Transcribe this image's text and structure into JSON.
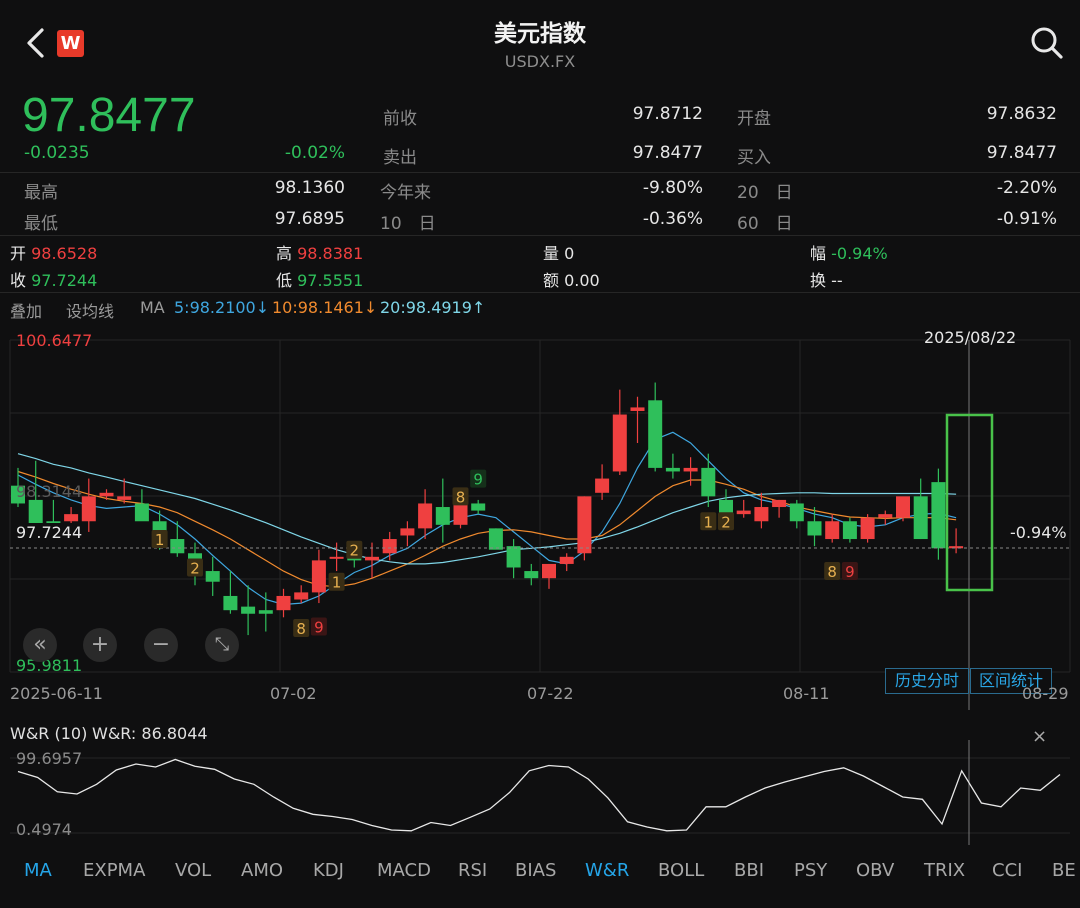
{
  "header": {
    "title": "美元指数",
    "subtitle": "USDX.FX",
    "logo": "W"
  },
  "quote": {
    "price": "97.8477",
    "change": "-0.0235",
    "change_pct": "-0.02%",
    "prev_close_label": "前收",
    "prev_close": "97.8712",
    "open_label": "开盘",
    "open": "97.8632",
    "sell_label": "卖出",
    "sell": "97.8477",
    "buy_label": "买入",
    "buy": "97.8477",
    "high_label": "最高",
    "high": "98.1360",
    "low_label": "最低",
    "low": "97.6895",
    "ytd_label": "今年来",
    "ytd": "-9.80%",
    "d20_label": "20　日",
    "d20": "-2.20%",
    "d10_label": "10　日",
    "d10": "-0.36%",
    "d60_label": "60　日",
    "d60": "-0.91%"
  },
  "bar_info": {
    "open_label": "开",
    "open": "98.6528",
    "high_label": "高",
    "high": "98.8381",
    "vol_label": "量",
    "vol": "0",
    "amp_label": "幅",
    "amp": "-0.94%",
    "close_label": "收",
    "close": "97.7244",
    "low_label": "低",
    "low": "97.5551",
    "amt_label": "额",
    "amt": "0.00",
    "turn_label": "换",
    "turn": "--"
  },
  "ma_bar": {
    "overlay": "叠加",
    "set_ma": "设均线",
    "ma": "MA",
    "ma5": "5:98.2100↓",
    "ma10": "10:98.1461↓",
    "ma20": "20:98.4919↑"
  },
  "colors": {
    "up": "#ef4040",
    "down": "#2fbf5b",
    "ma5": "#3fa7e0",
    "ma10": "#f08a2e",
    "ma20": "#7fd6e8",
    "accent": "#25a5e8"
  },
  "chart": {
    "y_max_label": "100.6477",
    "y_min_label": "95.9811",
    "cursor_price": "97.7244",
    "cursor_pct": "-0.94%",
    "cursor_date": "2025/08/22",
    "ghost_label": "98.3144",
    "dates": [
      "2025-06-11",
      "07-02",
      "07-22",
      "08-11",
      "08-29"
    ],
    "hist_btn": "历史分时",
    "range_btn": "区间统计",
    "td_marks": [
      "1",
      "2",
      "1",
      "2",
      "8",
      "9",
      "8",
      "9",
      "1",
      "2",
      "8",
      "9"
    ]
  },
  "chart_data": {
    "type": "candlestick",
    "ylim": [
      95.9811,
      100.6477
    ],
    "candles": [
      [
        98.6,
        98.85,
        98.3,
        98.35
      ],
      [
        98.4,
        98.95,
        98.0,
        98.05
      ],
      [
        98.1,
        98.4,
        97.9,
        98.0
      ],
      [
        98.1,
        98.3,
        97.95,
        98.2
      ],
      [
        98.1,
        98.7,
        97.95,
        98.45
      ],
      [
        98.45,
        98.55,
        98.4,
        98.5
      ],
      [
        98.4,
        98.7,
        98.35,
        98.45
      ],
      [
        98.35,
        98.55,
        98.2,
        98.1
      ],
      [
        98.1,
        98.25,
        97.7,
        97.8
      ],
      [
        97.85,
        98.1,
        97.6,
        97.65
      ],
      [
        97.65,
        97.8,
        97.2,
        97.4
      ],
      [
        97.4,
        97.6,
        97.05,
        97.25
      ],
      [
        97.05,
        97.4,
        96.8,
        96.85
      ],
      [
        96.9,
        97.2,
        96.5,
        96.8
      ],
      [
        96.85,
        97.1,
        96.55,
        96.8
      ],
      [
        96.85,
        97.15,
        96.75,
        97.05
      ],
      [
        97.0,
        97.2,
        96.95,
        97.1
      ],
      [
        97.1,
        97.7,
        96.95,
        97.55
      ],
      [
        97.6,
        97.8,
        97.4,
        97.6
      ],
      [
        97.6,
        97.75,
        97.45,
        97.55
      ],
      [
        97.55,
        97.8,
        97.3,
        97.6
      ],
      [
        97.65,
        97.95,
        97.55,
        97.85
      ],
      [
        97.9,
        98.1,
        97.75,
        98.0
      ],
      [
        98.0,
        98.55,
        97.85,
        98.35
      ],
      [
        98.3,
        98.7,
        97.8,
        98.05
      ],
      [
        98.05,
        98.45,
        98.0,
        98.35
      ],
      [
        98.35,
        98.4,
        98.2,
        98.25
      ],
      [
        98.0,
        98.0,
        97.75,
        97.7
      ],
      [
        97.75,
        97.85,
        97.3,
        97.45
      ],
      [
        97.4,
        97.5,
        97.2,
        97.3
      ],
      [
        97.3,
        97.5,
        97.15,
        97.5
      ],
      [
        97.5,
        97.65,
        97.4,
        97.6
      ],
      [
        97.65,
        98.45,
        97.55,
        98.45
      ],
      [
        98.5,
        98.9,
        98.4,
        98.7
      ],
      [
        98.8,
        99.95,
        98.75,
        99.6
      ],
      [
        99.65,
        99.85,
        99.2,
        99.7
      ],
      [
        99.8,
        100.05,
        98.8,
        98.85
      ],
      [
        98.85,
        99.05,
        98.7,
        98.8
      ],
      [
        98.8,
        99.0,
        98.6,
        98.85
      ],
      [
        98.85,
        99.05,
        98.3,
        98.45
      ],
      [
        98.4,
        98.55,
        98.1,
        98.2
      ],
      [
        98.2,
        98.4,
        98.15,
        98.25
      ],
      [
        98.1,
        98.5,
        98.0,
        98.3
      ],
      [
        98.3,
        98.4,
        98.15,
        98.4
      ],
      [
        98.35,
        98.4,
        98.0,
        98.1
      ],
      [
        98.1,
        98.3,
        97.75,
        97.9
      ],
      [
        97.85,
        98.2,
        97.8,
        98.1
      ],
      [
        98.1,
        98.15,
        97.8,
        97.85
      ],
      [
        97.85,
        98.2,
        97.8,
        98.15
      ],
      [
        98.15,
        98.25,
        98.05,
        98.2
      ],
      [
        98.15,
        98.4,
        98.1,
        98.45
      ],
      [
        98.45,
        98.7,
        97.85,
        97.85
      ],
      [
        98.65,
        98.84,
        97.56,
        97.72
      ],
      [
        97.72,
        98.0,
        97.65,
        97.75
      ]
    ],
    "ma5": [
      98.75,
      98.62,
      98.5,
      98.4,
      98.32,
      98.28,
      98.3,
      98.32,
      98.2,
      98.05,
      97.85,
      97.62,
      97.4,
      97.17,
      97.0,
      96.93,
      96.95,
      97.05,
      97.22,
      97.38,
      97.48,
      97.62,
      97.72,
      97.9,
      98.05,
      98.15,
      98.2,
      98.15,
      97.95,
      97.75,
      97.55,
      97.5,
      97.68,
      97.95,
      98.35,
      98.85,
      99.25,
      99.35,
      99.2,
      98.95,
      98.7,
      98.5,
      98.4,
      98.35,
      98.28,
      98.2,
      98.15,
      98.05,
      98.02,
      98.05,
      98.15,
      98.2,
      98.21,
      98.15
    ],
    "ma10": [
      98.8,
      98.72,
      98.63,
      98.55,
      98.48,
      98.42,
      98.38,
      98.35,
      98.3,
      98.22,
      98.1,
      97.98,
      97.85,
      97.7,
      97.55,
      97.4,
      97.28,
      97.2,
      97.18,
      97.22,
      97.3,
      97.4,
      97.5,
      97.62,
      97.75,
      97.85,
      97.93,
      97.97,
      97.98,
      97.95,
      97.9,
      97.85,
      97.85,
      97.9,
      98.05,
      98.25,
      98.45,
      98.6,
      98.68,
      98.68,
      98.62,
      98.55,
      98.45,
      98.38,
      98.3,
      98.25,
      98.2,
      98.16,
      98.15,
      98.14,
      98.15,
      98.15,
      98.15,
      98.12
    ],
    "ma20": [
      99.05,
      98.98,
      98.9,
      98.85,
      98.78,
      98.72,
      98.66,
      98.6,
      98.54,
      98.48,
      98.42,
      98.34,
      98.26,
      98.17,
      98.08,
      97.98,
      97.88,
      97.79,
      97.7,
      97.63,
      97.57,
      97.53,
      97.5,
      97.5,
      97.52,
      97.56,
      97.6,
      97.65,
      97.7,
      97.72,
      97.74,
      97.77,
      97.8,
      97.86,
      97.93,
      98.02,
      98.12,
      98.22,
      98.3,
      98.38,
      98.43,
      98.46,
      98.48,
      98.49,
      98.5,
      98.5,
      98.49,
      98.49,
      98.49,
      98.49,
      98.49,
      98.49,
      98.49,
      98.48
    ]
  },
  "wr": {
    "title": "W&R (10)",
    "value_label": "W&R: 86.8044",
    "y_max_label": "99.6957",
    "y_min_label": "0.4974",
    "values": [
      82,
      74,
      55,
      52,
      65,
      84,
      92,
      88,
      98,
      89,
      85,
      72,
      65,
      48,
      33,
      25,
      22,
      18,
      10,
      4,
      3,
      14,
      10,
      21,
      32,
      54,
      83,
      90,
      88,
      72,
      47,
      15,
      8,
      3,
      4,
      35,
      35,
      48,
      60,
      68,
      75,
      82,
      87,
      76,
      62,
      48,
      45,
      12,
      83,
      40,
      35,
      60,
      57,
      78
    ]
  },
  "indicators": {
    "items": [
      "MA",
      "EXPMA",
      "VOL",
      "AMO",
      "KDJ",
      "MACD",
      "RSI",
      "BIAS",
      "W&R",
      "BOLL",
      "BBI",
      "PSY",
      "OBV",
      "TRIX",
      "CCI",
      "BE"
    ]
  }
}
